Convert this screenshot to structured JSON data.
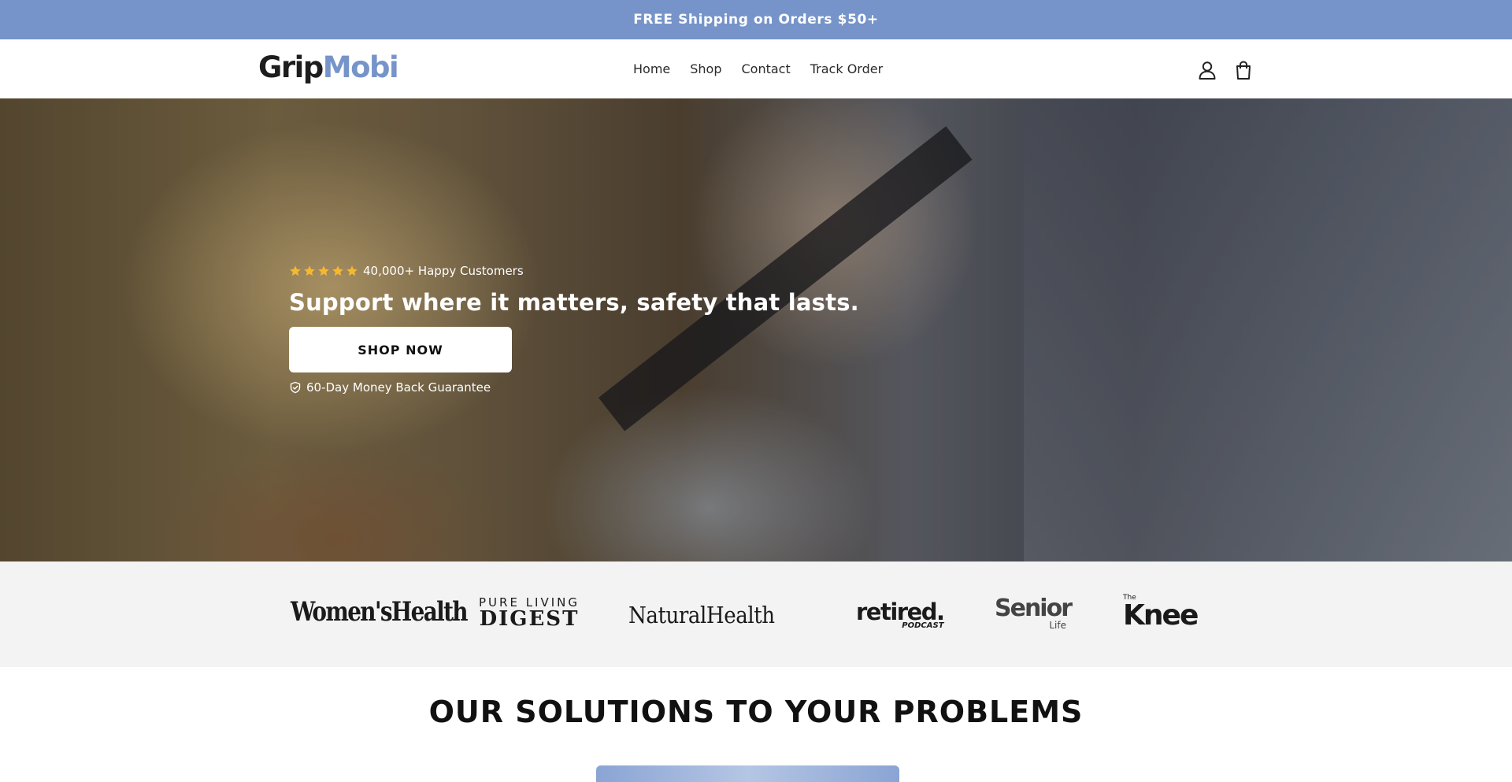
{
  "announcement": {
    "text": "FREE Shipping on Orders $50+"
  },
  "header": {
    "logo": {
      "part1": "Grip",
      "part2": "Mobi"
    },
    "nav": [
      {
        "label": "Home"
      },
      {
        "label": "Shop"
      },
      {
        "label": "Contact"
      },
      {
        "label": "Track Order"
      }
    ],
    "icons": [
      "account-icon",
      "cart-icon"
    ]
  },
  "hero": {
    "rating": {
      "stars": 5,
      "text": "40,000+ Happy Customers"
    },
    "headline": "Support where it matters, safety that lasts.",
    "cta_label": "SHOP NOW",
    "guarantee_text": "60-Day Money Back Guarantee"
  },
  "press_logos": [
    {
      "name": "Women'sHealth"
    },
    {
      "line1": "PURE LIVING",
      "line2": "DIGEST"
    },
    {
      "name": "NaturalHealth"
    },
    {
      "line1": "retired.",
      "line2": "PODCAST"
    },
    {
      "line1": "Senior",
      "line2": "Life"
    },
    {
      "line1": "The",
      "line2": "Knee"
    }
  ],
  "solutions": {
    "title": "OUR SOLUTIONS TO YOUR PROBLEMS"
  },
  "colors": {
    "brand_blue": "#7694c9",
    "star_gold": "#f5b82e",
    "press_bg": "#f3f3f3"
  }
}
